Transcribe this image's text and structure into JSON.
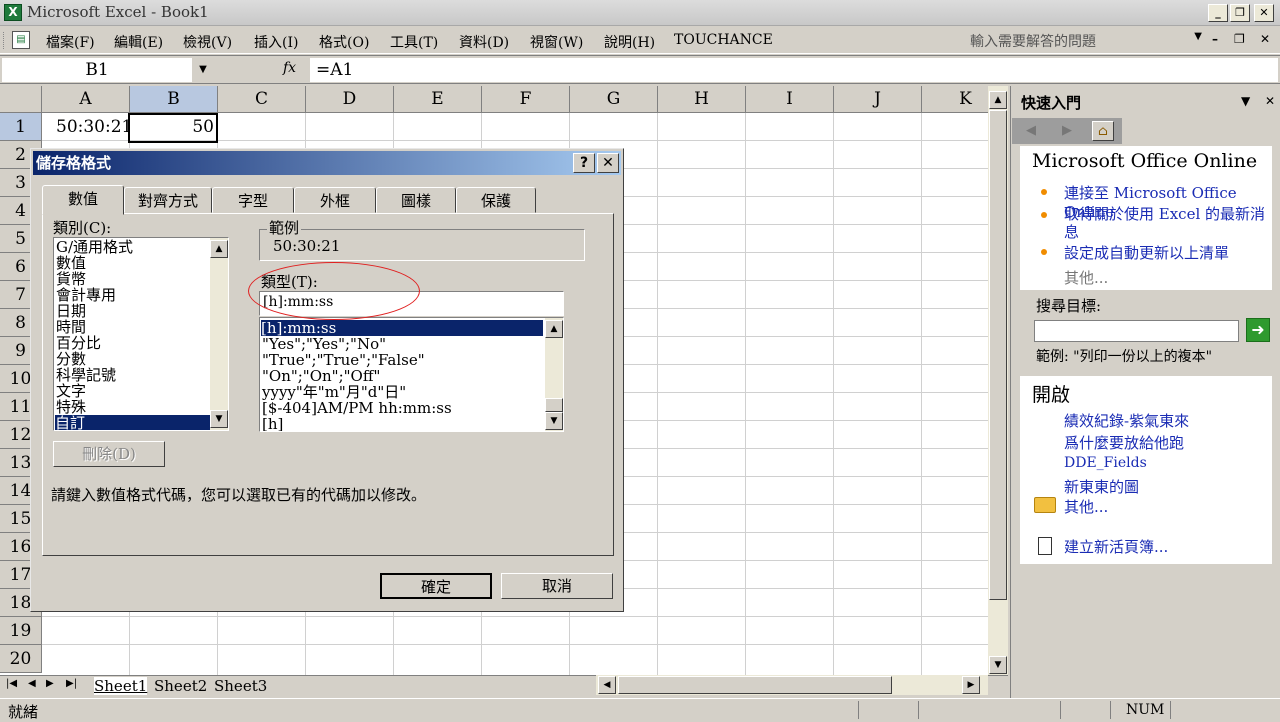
{
  "window": {
    "title": "Microsoft Excel - Book1",
    "app_icon": "X"
  },
  "menu": {
    "items": [
      "檔案(F)",
      "編輯(E)",
      "檢視(V)",
      "插入(I)",
      "格式(O)",
      "工具(T)",
      "資料(D)",
      "視窗(W)",
      "說明(H)",
      "TOUCHANCE"
    ],
    "help_placeholder": "輸入需要解答的問題"
  },
  "formula_bar": {
    "name_box": "B1",
    "fx": "fx",
    "formula": "=A1"
  },
  "sheet": {
    "columns": [
      "A",
      "B",
      "C",
      "D",
      "E",
      "F",
      "G",
      "H",
      "I",
      "J",
      "K"
    ],
    "rows": [
      "1",
      "2",
      "3",
      "4",
      "5",
      "6",
      "7",
      "8",
      "9",
      "10",
      "11",
      "12",
      "13",
      "14",
      "15",
      "16",
      "17",
      "18",
      "19",
      "20"
    ],
    "cells": {
      "A1": "50:30:21",
      "B1": "50"
    },
    "tabs": [
      "Sheet1",
      "Sheet2",
      "Sheet3"
    ]
  },
  "status": {
    "ready": "就緒",
    "num": "NUM"
  },
  "task_pane": {
    "title": "快速入門",
    "office_online": "Microsoft Office Online",
    "links": [
      "連接至 Microsoft Office Online",
      "取得關於使用 Excel 的最新消息",
      "設定成自動更新以上清單"
    ],
    "more": "其他...",
    "search_label": "搜尋目標:",
    "search_example": "範例: \"列印一份以上的複本\"",
    "open_heading": "開啟",
    "recent_files": [
      "績效紀錄-紫氣東來",
      "爲什麼要放給他跑",
      "DDE_Fields",
      "新東東的圖"
    ],
    "open_more": "其他...",
    "new_workbook": "建立新活頁簿..."
  },
  "dialog": {
    "title": "儲存格格式",
    "tabs": [
      "數值",
      "對齊方式",
      "字型",
      "外框",
      "圖樣",
      "保護"
    ],
    "category_label": "類別(C):",
    "categories": [
      "G/通用格式",
      "數值",
      "貨幣",
      "會計專用",
      "日期",
      "時間",
      "百分比",
      "分數",
      "科學記號",
      "文字",
      "特殊",
      "自訂"
    ],
    "selected_category": "自訂",
    "sample_label": "範例",
    "sample_value": "50:30:21",
    "type_label": "類型(T):",
    "type_value": "[h]:mm:ss",
    "type_list": [
      "[h]:mm:ss",
      "\"Yes\";\"Yes\";\"No\"",
      "\"True\";\"True\";\"False\"",
      "\"On\";\"On\";\"Off\"",
      "yyyy\"年\"m\"月\"d\"日\"",
      "[$-404]AM/PM hh:mm:ss",
      "[h]"
    ],
    "delete_button": "刪除(D)",
    "hint": "請鍵入數值格式代碼，您可以選取已有的代碼加以修改。",
    "ok_button": "確定",
    "cancel_button": "取消"
  }
}
